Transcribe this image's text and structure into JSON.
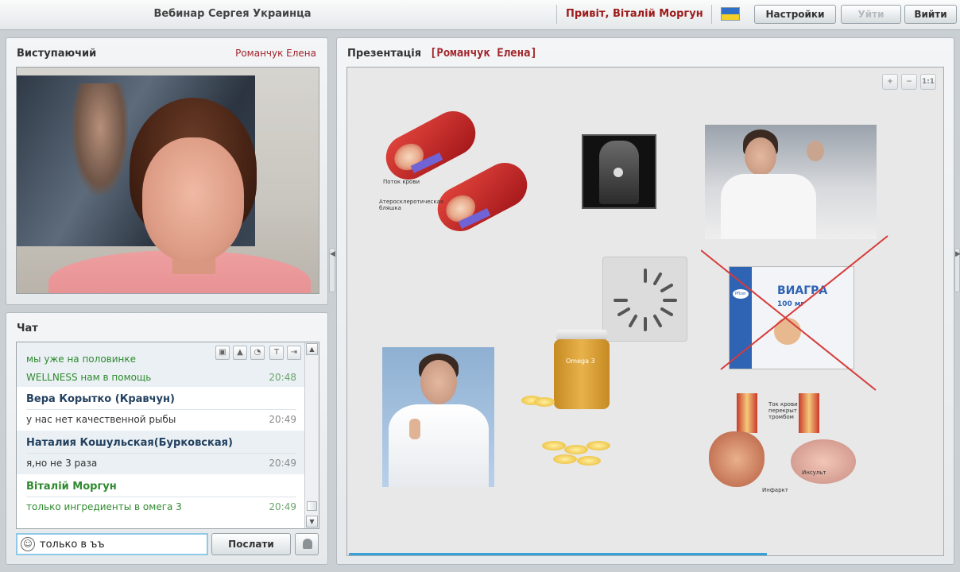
{
  "header": {
    "title": "Вебинар Сергея Украинца",
    "greeting": "Привіт, Віталій Моргун",
    "buttons": {
      "settings": "Настройки",
      "leave": "Уйти",
      "exit": "Вийти"
    },
    "flag_colors": [
      "#2f6fc7",
      "#f4cf2a"
    ]
  },
  "speaker_panel": {
    "title": "Виступаючий",
    "speaker_name": "Романчук Елена"
  },
  "chat": {
    "title": "Чат",
    "messages": [
      {
        "text": "мы уже на половинке",
        "time": ""
      },
      {
        "text": "WELLNESS нам в помощь",
        "time": "20:48"
      },
      {
        "author": "Вера Корытко (Кравчун)",
        "text": "у нас нет качественной рыбы",
        "time": "20:49"
      },
      {
        "author": "Наталия Кошульская(Бурковская)",
        "text": "я,но не 3 раза",
        "time": "20:49"
      },
      {
        "author": "Віталій Моргун",
        "text": "только ингредиенты в омега 3",
        "time": "20:49"
      }
    ],
    "input_value": "только в ъъ",
    "send_label": "Послати",
    "tool_icons": [
      "image-icon",
      "warning-icon",
      "clock-icon",
      "text-size-icon",
      "export-icon"
    ]
  },
  "presentation": {
    "title": "Презентація",
    "speaker": "[Романчук Елена]",
    "zoom_labels": {
      "zoom_in": "+",
      "zoom_out": "−",
      "actual": "1:1"
    },
    "slide_labels": {
      "blood_flow": "Поток крови",
      "plaque": "Атеросклеротическая бляшка",
      "viagra": "ВИАГРА",
      "viagra_dose": "100 мг",
      "thrombus": "Ток крови перекрыт тромбом",
      "infarct": "Инфаркт",
      "stroke": "Инсульт",
      "omega": "Omega 3",
      "pfizer": "Pfizer"
    },
    "accent_color": "#3aa1d8"
  }
}
